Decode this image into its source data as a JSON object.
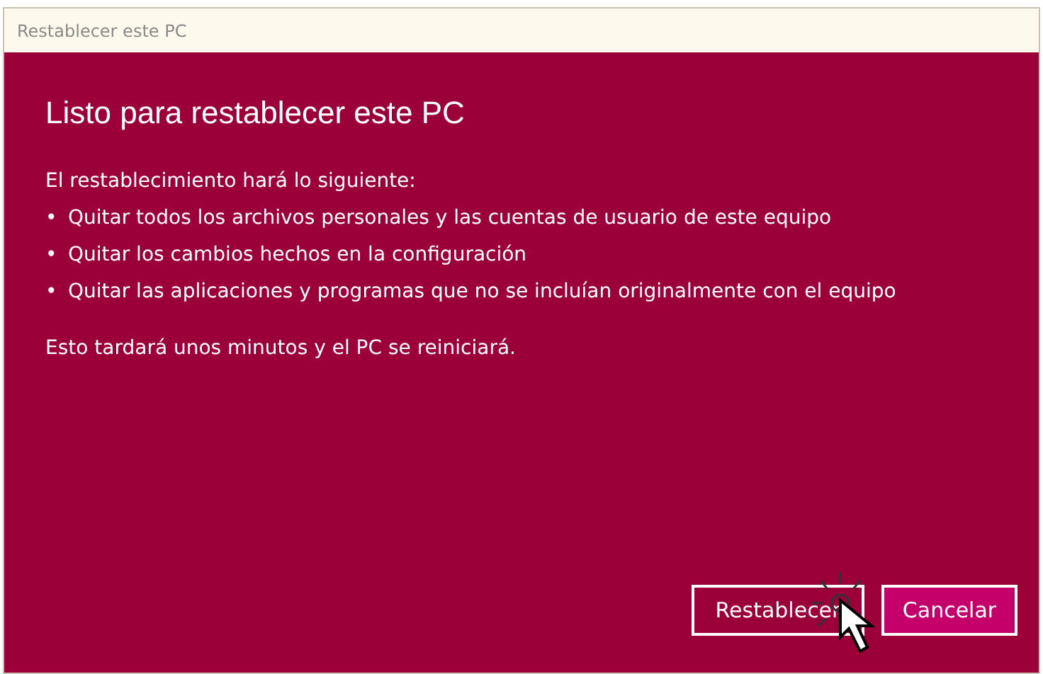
{
  "window": {
    "title": "Restablecer este PC"
  },
  "heading": "Listo para restablecer este PC",
  "intro": "El restablecimiento hará lo siguiente:",
  "bullets": [
    {
      "marker": "•",
      "text": "Quitar todos los archivos personales y las cuentas de usuario de este equipo"
    },
    {
      "marker": "•",
      "text": "Quitar los cambios hechos en la configuración"
    },
    {
      "marker": "•",
      "text": "Quitar las aplicaciones y programas que no se incluían originalmente con el equipo"
    }
  ],
  "note": "Esto tardará unos minutos y el PC se reiniciará.",
  "buttons": [
    {
      "label": "Restablecer",
      "kind": "outline"
    },
    {
      "label": "Cancelar",
      "kind": "filled"
    }
  ]
}
